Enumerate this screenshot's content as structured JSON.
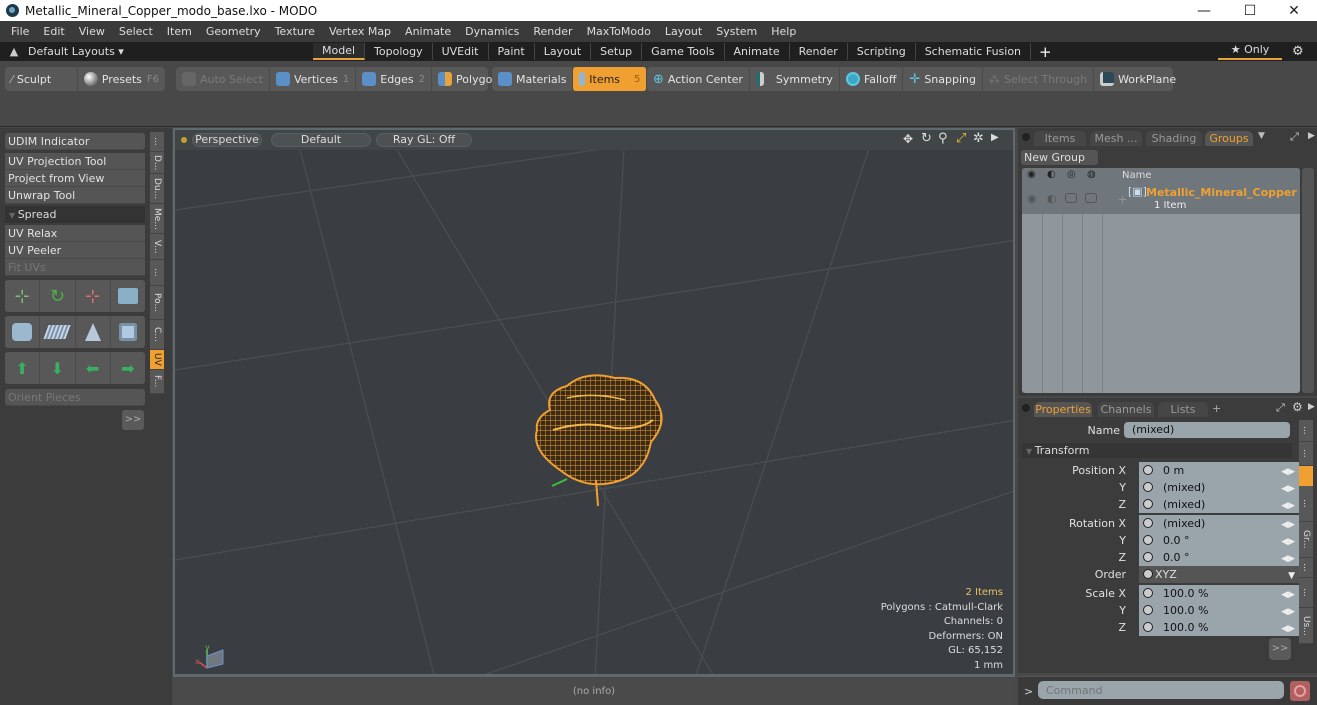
{
  "window": {
    "title": "Metallic_Mineral_Copper_modo_base.lxo - MODO",
    "minimize": "—",
    "maximize": "☐",
    "close": "✕"
  },
  "menu": [
    "File",
    "Edit",
    "View",
    "Select",
    "Item",
    "Geometry",
    "Texture",
    "Vertex Map",
    "Animate",
    "Dynamics",
    "Render",
    "MaxToModo",
    "Layout",
    "System",
    "Help"
  ],
  "layouts": {
    "dropdown": "Default Layouts ▾",
    "tabs": [
      "Model",
      "Topology",
      "UVEdit",
      "Paint",
      "Layout",
      "Setup",
      "Game Tools",
      "Animate",
      "Render",
      "Scripting",
      "Schematic Fusion"
    ],
    "active_tab": "Model",
    "add": "+",
    "only": "★ Only",
    "gear": "⚙"
  },
  "toolbar": {
    "sculpt": "Sculpt",
    "presets": "Presets",
    "presets_key": "F6",
    "auto_select": "Auto Select",
    "vertices": "Vertices",
    "vertices_key": "1",
    "edges": "Edges",
    "edges_key": "2",
    "polygons": "Polygons",
    "materials": "Materials",
    "items": "Items",
    "items_key": "5",
    "action_center": "Action Center",
    "symmetry": "Symmetry",
    "falloff": "Falloff",
    "snapping": "Snapping",
    "select_through": "Select Through",
    "workplane": "WorkPlane"
  },
  "left_panel": {
    "udim": "UDIM Indicator",
    "tools": [
      "UV Projection Tool",
      "Project from View",
      "Unwrap Tool"
    ],
    "spread": "Spread",
    "tools2": [
      "UV Relax",
      "UV Peeler",
      "Fit UVs"
    ],
    "orient": "Orient Pieces",
    "more": ">>",
    "vtabs": [
      "...",
      "D...",
      "Du...",
      "Me...",
      "V...",
      "...",
      "Po...",
      "C...",
      "UV",
      "F..."
    ],
    "active_vtab": "UV"
  },
  "viewport": {
    "view": "Perspective",
    "shading": "Default",
    "raygl": "Ray GL: Off",
    "info": {
      "items": "2 Items",
      "polygons": "Polygons : Catmull-Clark",
      "channels": "Channels: 0",
      "deformers": "Deformers: ON",
      "gl": "GL: 65,152",
      "unit": "1 mm"
    },
    "status": "(no info)"
  },
  "groups_panel": {
    "tabs": [
      "Items",
      "Mesh ...",
      "Shading",
      "Groups"
    ],
    "active_tab": "Groups",
    "new_group": "New Group",
    "col_name": "Name",
    "group_name": "Metallic_Mineral_Copper",
    "group_count": "1 Item"
  },
  "properties_panel": {
    "tabs": [
      "Properties",
      "Channels",
      "Lists",
      "+"
    ],
    "active_tab": "Properties",
    "name_label": "Name",
    "name_value": "(mixed)",
    "section": "Transform",
    "rows": [
      {
        "label": "Position X",
        "value": "0 m"
      },
      {
        "label": "Y",
        "value": "(mixed)"
      },
      {
        "label": "Z",
        "value": "(mixed)"
      },
      {
        "label": "Rotation X",
        "value": "(mixed)"
      },
      {
        "label": "Y",
        "value": "0.0 °"
      },
      {
        "label": "Z",
        "value": "0.0 °"
      },
      {
        "label": "Order",
        "value": "XYZ"
      },
      {
        "label": "Scale X",
        "value": "100.0 %"
      },
      {
        "label": "Y",
        "value": "100.0 %"
      },
      {
        "label": "Z",
        "value": "100.0 %"
      }
    ],
    "more": ">>",
    "side_tabs": [
      "...",
      "...",
      "...",
      "Gr...",
      "...",
      "...",
      "Us..."
    ]
  },
  "command": {
    "prompt": ">",
    "placeholder": "Command"
  },
  "colors": {
    "accent": "#f0a030",
    "mesh": "#f0a030",
    "viewport_bg": "#3a3e42"
  }
}
